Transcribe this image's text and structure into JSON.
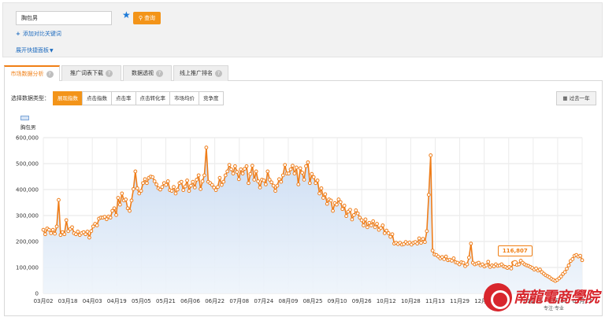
{
  "search": {
    "value": "胸包男",
    "query_label": "查询",
    "add_compare": "添加对比关键词",
    "quick_panel": "展开快捷面板"
  },
  "tabs": [
    {
      "label": "市场数据分析",
      "active": true
    },
    {
      "label": "推广词表下载",
      "active": false
    },
    {
      "label": "数据透视",
      "active": false
    },
    {
      "label": "线上推广排名",
      "active": false
    }
  ],
  "type_selector": {
    "label": "选择数据类型：",
    "options": [
      "展现指数",
      "点击指数",
      "点击率",
      "点击转化率",
      "市场均价",
      "竞争度"
    ],
    "selected": "展现指数"
  },
  "range_button": "过去一年",
  "legend": {
    "label": "胸包男"
  },
  "tooltip": {
    "value": "116,807"
  },
  "watermark": {
    "title": "南龍電商學院",
    "sub": "专注·专业"
  },
  "colors": {
    "accent": "#f39419",
    "line": "#ef7d19",
    "fill_top": "#cadcf2",
    "link": "#1d6bbf"
  },
  "chart_data": {
    "type": "area",
    "series": [
      {
        "name": "胸包男"
      }
    ],
    "x_ticks": [
      "03月02",
      "03月18",
      "04月03",
      "04月19",
      "05月05",
      "05月21",
      "06月06",
      "06月22",
      "07月08",
      "07月24",
      "08月09",
      "08月25",
      "09月10",
      "09月26",
      "10月12",
      "10月28",
      "11月13",
      "11月29",
      "12月15",
      "",
      "01月16",
      "01月01",
      "02月17"
    ],
    "y_ticks": [
      "0",
      "100,000",
      "200,000",
      "300,000",
      "400,000",
      "500,000",
      "600,000"
    ],
    "ylim": [
      0,
      600000
    ],
    "grid": true,
    "values": [
      245000,
      228000,
      250000,
      245000,
      232000,
      245000,
      230000,
      258000,
      360000,
      225000,
      236000,
      228000,
      282000,
      240000,
      248000,
      255000,
      232000,
      228000,
      238000,
      225000,
      232000,
      236000,
      228000,
      238000,
      215000,
      240000,
      258000,
      268000,
      262000,
      288000,
      292000,
      292000,
      295000,
      286000,
      296000,
      292000,
      318000,
      328000,
      302000,
      368000,
      342000,
      385000,
      358000,
      362000,
      328000,
      318000,
      358000,
      402000,
      470000,
      405000,
      385000,
      395000,
      425000,
      440000,
      425000,
      445000,
      450000,
      448000,
      432000,
      420000,
      405000,
      400000,
      410000,
      425000,
      418000,
      432000,
      398000,
      395000,
      410000,
      385000,
      400000,
      425000,
      430000,
      398000,
      412000,
      435000,
      395000,
      415000,
      430000,
      408000,
      438000,
      455000,
      402000,
      432000,
      455000,
      562000,
      430000,
      425000,
      418000,
      408000,
      398000,
      410000,
      445000,
      418000,
      430000,
      455000,
      470000,
      495000,
      478000,
      462000,
      490000,
      468000,
      440000,
      478000,
      462000,
      480000,
      490000,
      425000,
      460000,
      492000,
      438000,
      470000,
      432000,
      408000,
      438000,
      435000,
      420000,
      470000,
      438000,
      428000,
      415000,
      395000,
      415000,
      440000,
      430000,
      455000,
      495000,
      462000,
      462000,
      478000,
      492000,
      462000,
      485000,
      420000,
      482000,
      465000,
      438000,
      490000,
      505000,
      425000,
      460000,
      448000,
      425000,
      435000,
      385000,
      405000,
      368000,
      382000,
      345000,
      362000,
      358000,
      318000,
      348000,
      342000,
      362000,
      352000,
      325000,
      338000,
      298000,
      315000,
      322000,
      285000,
      302000,
      320000,
      308000,
      292000,
      282000,
      262000,
      285000,
      255000,
      272000,
      262000,
      278000,
      255000,
      268000,
      245000,
      252000,
      262000,
      232000,
      242000,
      232000,
      218000,
      228000,
      192000,
      195000,
      190000,
      195000,
      188000,
      190000,
      198000,
      192000,
      196000,
      188000,
      195000,
      198000,
      192000,
      212000,
      195000,
      210000,
      198000,
      240000,
      380000,
      532000,
      165000,
      150000,
      148000,
      142000,
      135000,
      140000,
      132000,
      142000,
      128000,
      130000,
      126000,
      135000,
      120000,
      118000,
      112000,
      120000,
      118000,
      105000,
      112000,
      138000,
      192000,
      118000,
      112000,
      115000,
      118000,
      108000,
      112000,
      104000,
      108000,
      122000,
      102000,
      108000,
      104000,
      112000,
      106000,
      108000,
      112000,
      104000,
      102000,
      98000,
      102000,
      96000,
      118000,
      116807,
      110000,
      112000,
      126000,
      118000,
      112000,
      108000,
      106000,
      102000,
      98000,
      92000,
      96000,
      88000,
      92000,
      82000,
      76000,
      70000,
      66000,
      62000,
      56000,
      52000,
      48000,
      52000,
      58000,
      65000,
      75000,
      82000,
      95000,
      108000,
      125000,
      132000,
      145000,
      148000,
      142000,
      145000,
      128000
    ]
  }
}
